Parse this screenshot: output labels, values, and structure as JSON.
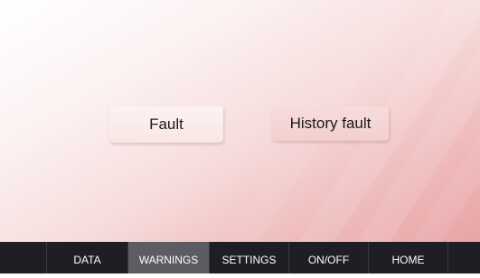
{
  "screen": {
    "buttons": {
      "fault_label": "Fault",
      "history_fault_label": "History fault"
    }
  },
  "navbar": {
    "items": [
      {
        "label": "DATA",
        "active": false
      },
      {
        "label": "WARNINGS",
        "active": true
      },
      {
        "label": "SETTINGS",
        "active": false
      },
      {
        "label": "ON/OFF",
        "active": false
      },
      {
        "label": "HOME",
        "active": false
      }
    ]
  },
  "colors": {
    "navbar_background": "#1e1e24",
    "active_tab_background": "#5b5d63",
    "screen_gradient_end": "#e8a4a5"
  }
}
